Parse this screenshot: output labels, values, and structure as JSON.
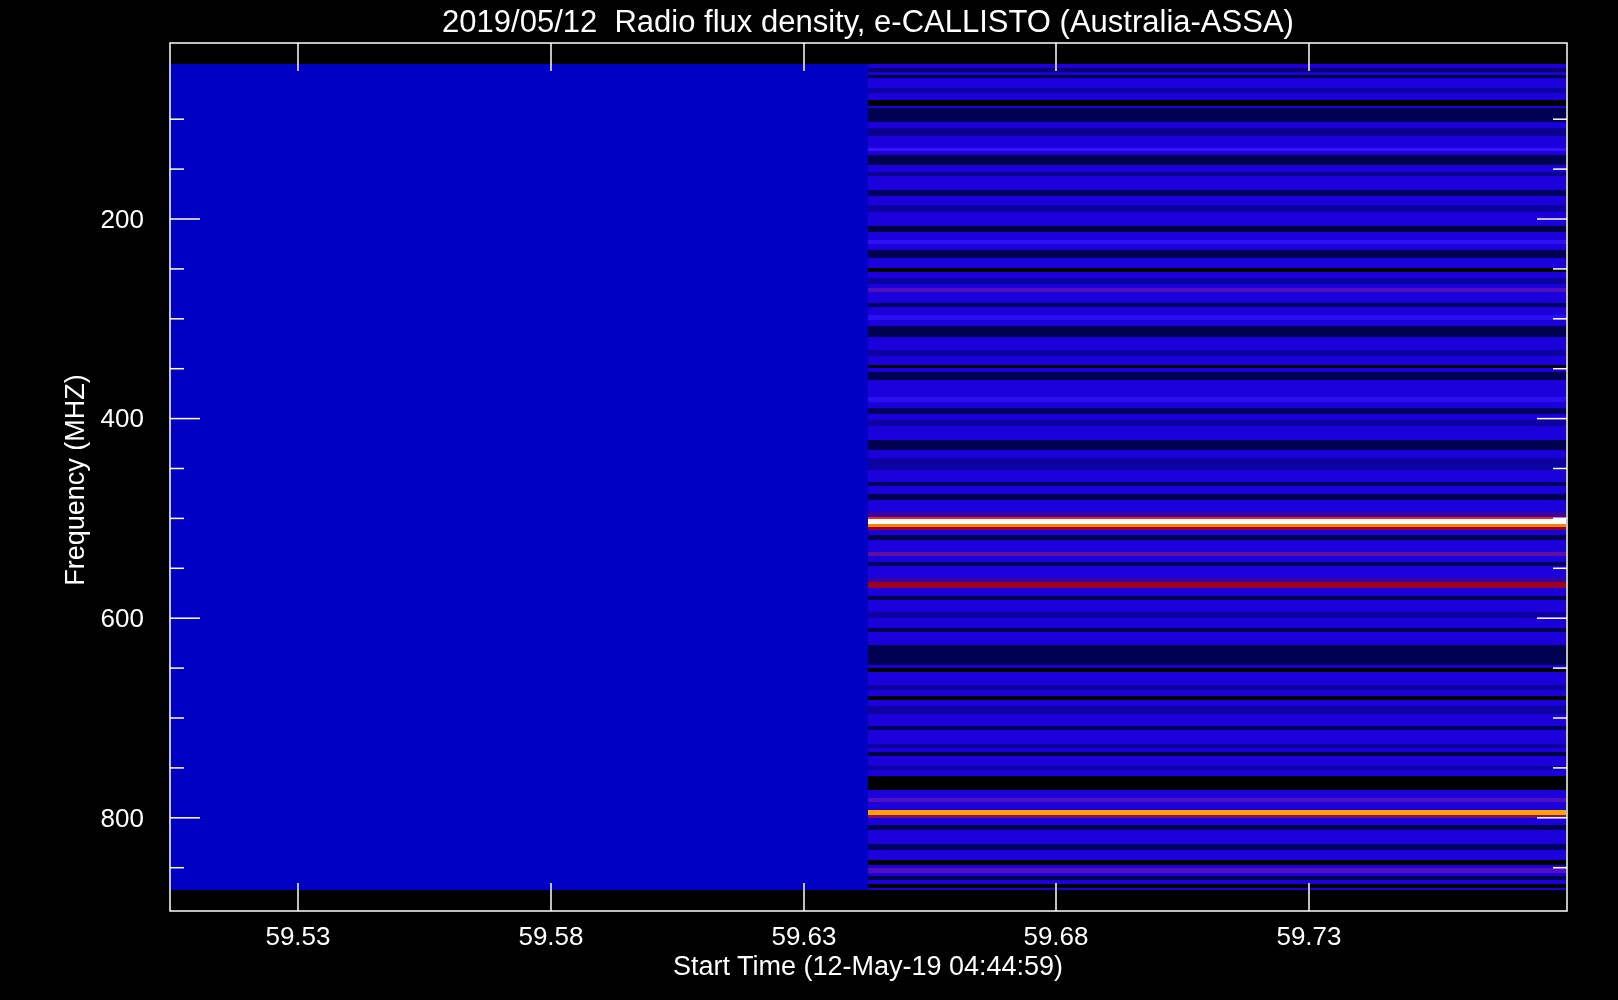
{
  "plot": {
    "title": "2019/05/12  Radio flux density, e-CALLISTO (Australia-ASSA)",
    "x_axis": {
      "label": "Start Time (12-May-19 04:44:59)",
      "ticks": [
        "59.53",
        "59.58",
        "59.63",
        "59.68",
        "59.73"
      ]
    },
    "y_axis": {
      "label": "Frequency (MHZ)",
      "ticks": [
        "200",
        "400",
        "600",
        "800"
      ]
    }
  }
}
